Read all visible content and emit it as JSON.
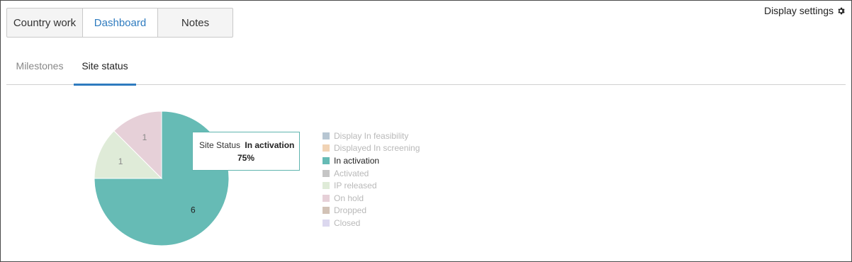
{
  "top_tabs": [
    {
      "label": "Country work"
    },
    {
      "label": "Dashboard",
      "active_color": "#2e7bbf"
    },
    {
      "label": "Notes"
    }
  ],
  "display_settings": {
    "label": "Display settings",
    "icon": "gear-icon"
  },
  "sub_tabs": [
    {
      "label": "Milestones"
    },
    {
      "label": "Site status"
    }
  ],
  "chart_data": {
    "type": "pie",
    "title": "",
    "slices": [
      {
        "category": "In activation",
        "value": 6,
        "color": "#66bbb5",
        "label": "6"
      },
      {
        "category": "IP released",
        "value": 1,
        "color": "#dfebd8",
        "label": "1"
      },
      {
        "category": "On hold",
        "value": 1,
        "color": "#e6d0d8",
        "label": "1"
      }
    ],
    "legend": [
      {
        "label": "Display In feasibility",
        "color": "#b7c6d2",
        "dimmed": true
      },
      {
        "label": "Displayed In screening",
        "color": "#f1d3b5",
        "dimmed": true
      },
      {
        "label": "In activation",
        "color": "#66bbb5",
        "dimmed": false
      },
      {
        "label": "Activated",
        "color": "#c5c5c5",
        "dimmed": true
      },
      {
        "label": "IP released",
        "color": "#dfebd8",
        "dimmed": true
      },
      {
        "label": "On hold",
        "color": "#e6d0d8",
        "dimmed": true
      },
      {
        "label": "Dropped",
        "color": "#d2c2b6",
        "dimmed": true
      },
      {
        "label": "Closed",
        "color": "#dcd8ef",
        "dimmed": true
      }
    ],
    "legend_placement": "right"
  },
  "tooltip": {
    "key": "Site Status",
    "value": "In activation",
    "percent": "75%"
  }
}
